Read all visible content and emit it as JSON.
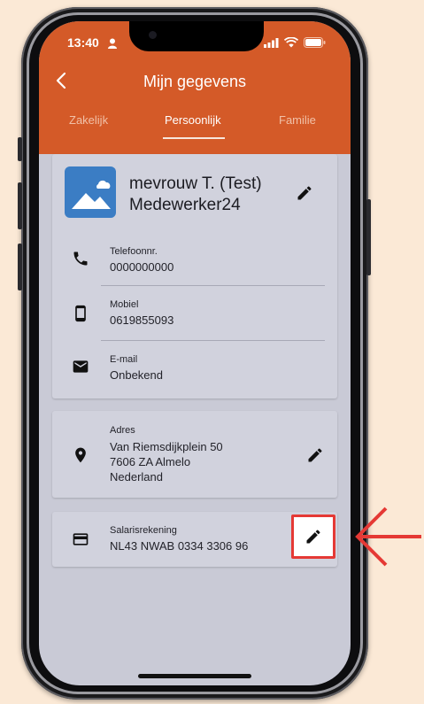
{
  "status_bar": {
    "time": "13:40"
  },
  "header": {
    "title": "Mijn gegevens",
    "tabs": [
      {
        "label": "Zakelijk",
        "active": false
      },
      {
        "label": "Persoonlijk",
        "active": true
      },
      {
        "label": "Familie",
        "active": false
      }
    ]
  },
  "profile": {
    "name_line1": "mevrouw T. (Test)",
    "name_line2": "Medewerker24",
    "contacts": [
      {
        "label": "Telefoonnr.",
        "value": "0000000000",
        "icon": "phone-icon"
      },
      {
        "label": "Mobiel",
        "value": "0619855093",
        "icon": "smartphone-icon"
      },
      {
        "label": "E-mail",
        "value": "Onbekend",
        "icon": "mail-icon"
      }
    ]
  },
  "address": {
    "label": "Adres",
    "line1": "Van Riemsdijkplein 50",
    "line2": "7606 ZA Almelo",
    "line3": "Nederland",
    "icon": "location-pin-icon"
  },
  "bank": {
    "label": "Salarisrekening",
    "value": "NL43 NWAB 0334 3306 96",
    "icon": "credit-card-icon"
  },
  "colors": {
    "brand": "#d45a28",
    "background": "#c9cad6",
    "card": "#d1d2dd",
    "highlight": "#e53935"
  }
}
